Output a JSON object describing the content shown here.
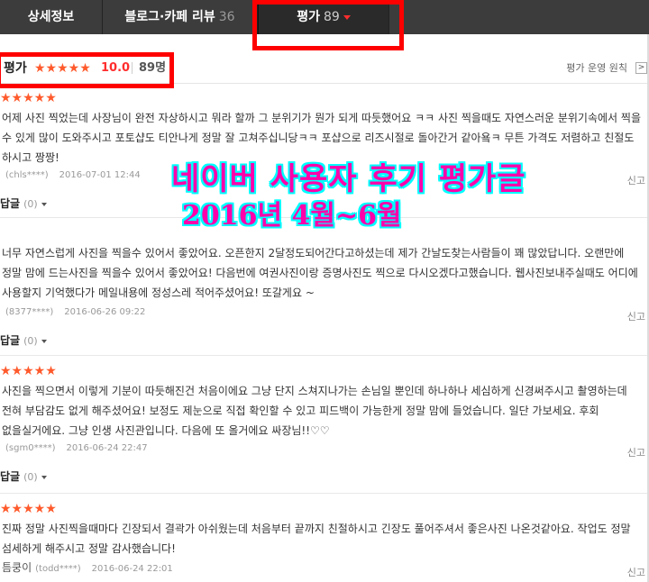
{
  "tabs": [
    {
      "label": "상세정보",
      "count": ""
    },
    {
      "label": "블로그·카페 리뷰",
      "count": "36"
    },
    {
      "label": "평가",
      "count": "89"
    }
  ],
  "summary": {
    "title": "평가",
    "stars": "★★★★★",
    "score": "10.0",
    "count": "89명",
    "policy_link": "평가 운영 원칙",
    "policy_btn": ">"
  },
  "overlay": {
    "line1": "네이버 사용자 후기 평가글",
    "line2": "2016년 4월~6월"
  },
  "reviews": [
    {
      "stars": "★★★★★",
      "text": "어제 사진 찍었는데 사장님이 완전 자상하시고 뭐라 할까 그 분위기가 뭔가 되게 따듯했어요 ㅋㅋ 사진 찍을때도 자연스러운 분위기속에서 찍을 수 있게 많이 도와주시고 포토샵도 티안나게 정말 잘 고쳐주십니당ㅋㅋ 포샵으로 리즈시절로 돌아간거 같아욬ㅋ 무튼 가격도 저렴하고 친절도 하시고 짱짱!",
      "nickname": "",
      "user": "(chls****)",
      "date": "2016-07-01 12:44",
      "report": "신고",
      "reply_label": "답글",
      "reply_count": "(0)"
    },
    {
      "stars": "",
      "text": "너무 자연스럽게 사진을 찍을수 있어서 좋았어요. 오픈한지 2달정도되어간다고하셨는데 제가 간날도찾는사람들이 꽤 많았답니다. 오랜만에 정말 맘에 드는사진을 찍을수 있어서 좋았어요! 다음번에 여권사진이랑 증명사진도 찍으로 다시오겠다고했습니다. 웹사진보내주실때도 어디에 사용할지 기억했다가 메일내용에 정성스레 적어주셨어요! 또갈게요 ~",
      "nickname": "",
      "user": "(8377****)",
      "date": "2016-06-26 09:22",
      "report": "신고",
      "reply_label": "답글",
      "reply_count": "(0)"
    },
    {
      "stars": "★★★★★",
      "text": "사진을 찍으면서 이렇게 기분이 따듯해진건 처음이에요 그냥 단지 스쳐지나가는 손님일 뿐인데 하나하나 세심하게 신경써주시고 촬영하는데 전혀 부담감도 없게 해주셨어요! 보정도 제눈으로 직접 확인할 수 있고 피드백이 가능한게 정말 맘에 들었습니다. 일단 가보세요. 후회 없을실거에요. 그냥 인생 사진관입니다. 다음에 또 올거에요 싸장님!!♡♡",
      "nickname": "",
      "user": "(sgm0****)",
      "date": "2016-06-24 22:47",
      "report": "신고",
      "reply_label": "답글",
      "reply_count": "(0)"
    },
    {
      "stars": "★★★★★",
      "text": "진짜 정말 사진찍을때마다 긴장되서 결곽가 아쉬웠는데 처음부터 끝까지 친절하시고 긴장도 풀어주셔서 좋은사진 나온것같아요. 작업도 정말 섬세하게 해주시고 정말 감사했습니다!",
      "nickname": "틈쿵이",
      "user": "(todd****)",
      "date": "2016-06-24 22:01",
      "report": "신고",
      "reply_label": "",
      "reply_count": ""
    }
  ],
  "colors": {
    "tabbar": "#3c3c3c",
    "star": "#ff5a2c",
    "score": "#ff2d2d",
    "highlight_box": "#ff0000",
    "overlay_text": "#ff00aa",
    "overlay_outline": "#00ffff"
  }
}
